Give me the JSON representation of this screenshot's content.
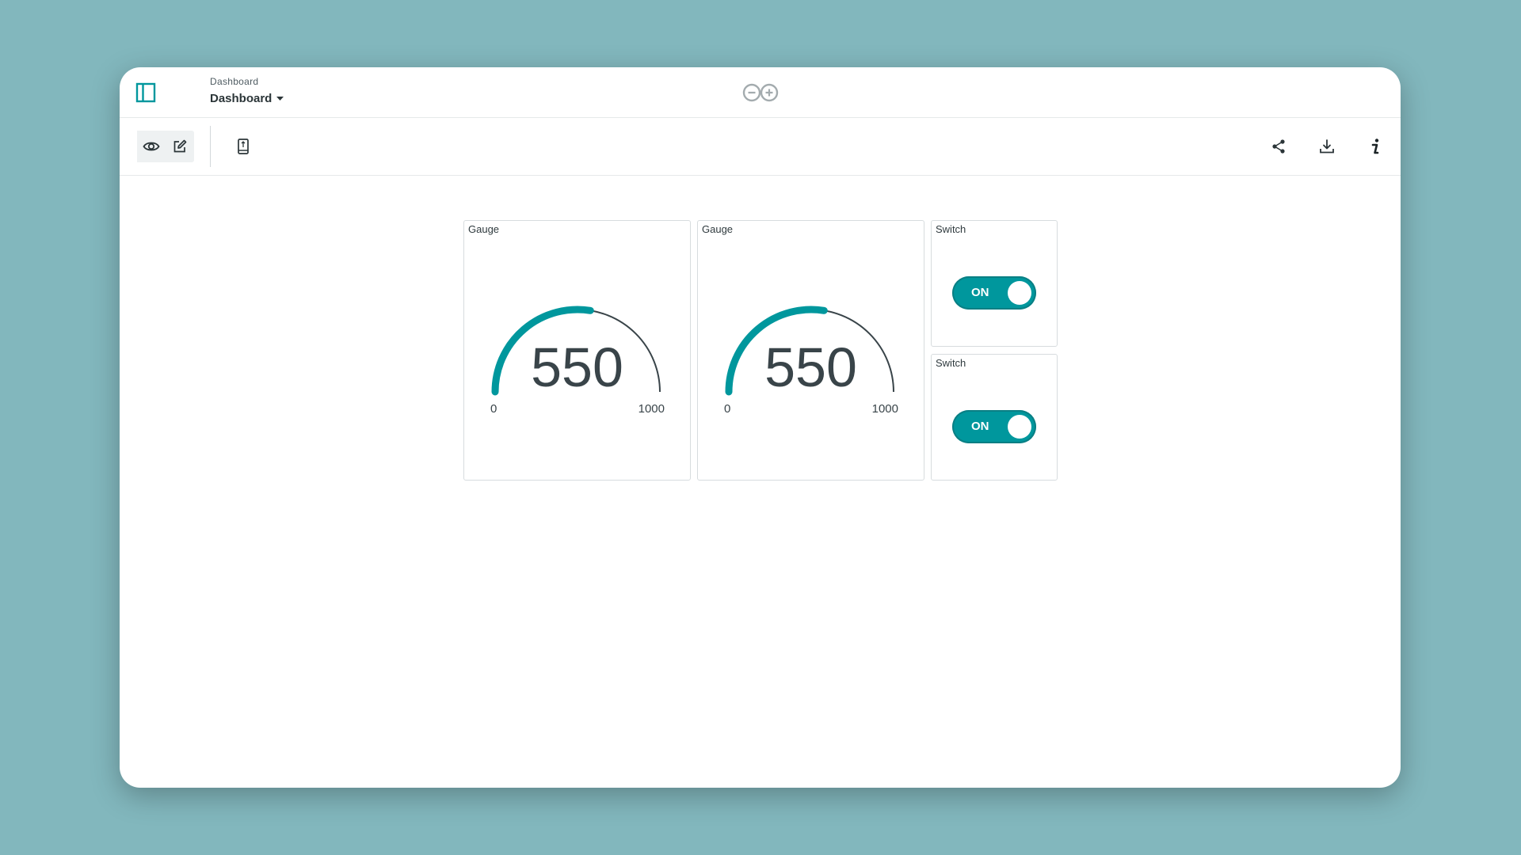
{
  "colors": {
    "accent": "#00979d",
    "background": "#82b7bd",
    "text": "#394449",
    "gauge_track": "#394449"
  },
  "header": {
    "breadcrumb": "Dashboard",
    "title": "Dashboard",
    "sidebar_icon": "sidebar-icon",
    "logo_icon": "arduino-infinity-logo"
  },
  "toolbar": {
    "view_icon": "eye-icon",
    "edit_icon": "pencil-edit-icon",
    "mobile_icon": "mobile-phone-icon",
    "share_icon": "share-icon",
    "download_icon": "download-icon",
    "info_icon": "info-icon"
  },
  "widgets": {
    "gauge1": {
      "title": "Gauge",
      "value": "550",
      "min": "0",
      "max": "1000",
      "fraction": 0.55
    },
    "gauge2": {
      "title": "Gauge",
      "value": "550",
      "min": "0",
      "max": "1000",
      "fraction": 0.55
    },
    "switch1": {
      "title": "Switch",
      "state": "ON"
    },
    "switch2": {
      "title": "Switch",
      "state": "ON"
    }
  }
}
